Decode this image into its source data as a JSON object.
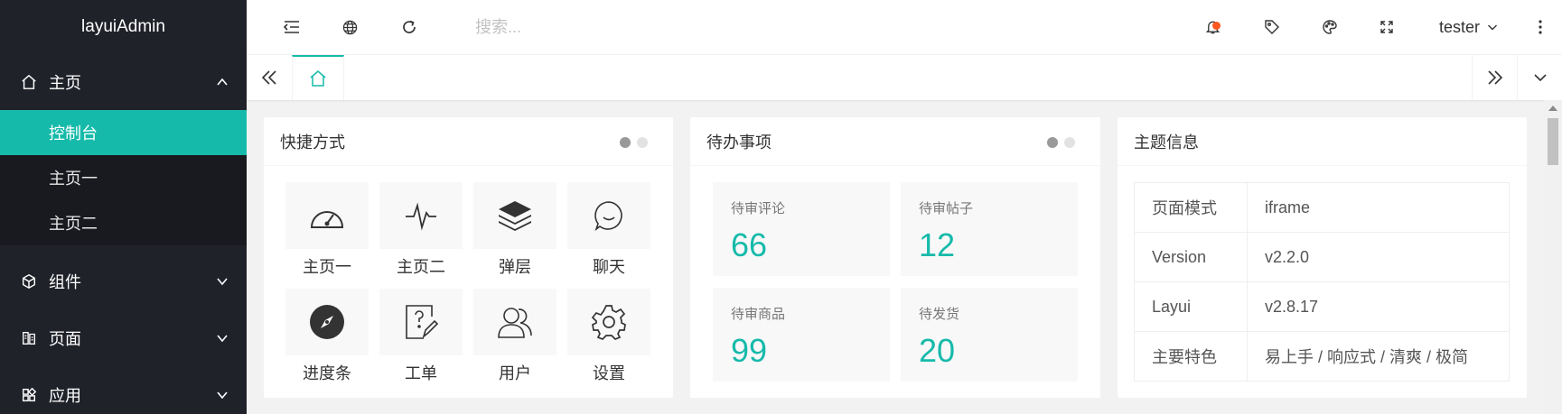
{
  "sidebar": {
    "logo": "layuiAdmin",
    "groups": [
      {
        "label": "主页",
        "icon": "home-icon",
        "expanded": true,
        "children": [
          {
            "label": "控制台",
            "active": true
          },
          {
            "label": "主页一"
          },
          {
            "label": "主页二"
          }
        ]
      },
      {
        "label": "组件",
        "icon": "component-icon"
      },
      {
        "label": "页面",
        "icon": "page-icon"
      },
      {
        "label": "应用",
        "icon": "app-icon"
      }
    ]
  },
  "header": {
    "search_placeholder": "搜索...",
    "user": "tester",
    "icons": [
      "menu-collapse-icon",
      "globe-icon",
      "refresh-icon",
      "bell-icon",
      "tag-icon",
      "palette-icon",
      "fullscreen-icon",
      "more-vertical-icon"
    ]
  },
  "tabs": {
    "home_icon": "home-icon"
  },
  "cards": {
    "shortcuts": {
      "title": "快捷方式",
      "items": [
        {
          "label": "主页一",
          "icon": "dashboard-icon"
        },
        {
          "label": "主页二",
          "icon": "pulse-icon"
        },
        {
          "label": "弹层",
          "icon": "layers-icon"
        },
        {
          "label": "聊天",
          "icon": "chat-icon"
        },
        {
          "label": "进度条",
          "icon": "compass-icon"
        },
        {
          "label": "工单",
          "icon": "ticket-icon"
        },
        {
          "label": "用户",
          "icon": "users-icon"
        },
        {
          "label": "设置",
          "icon": "gear-icon"
        }
      ]
    },
    "todo": {
      "title": "待办事项",
      "items": [
        {
          "label": "待审评论",
          "value": "66"
        },
        {
          "label": "待审帖子",
          "value": "12"
        },
        {
          "label": "待审商品",
          "value": "99"
        },
        {
          "label": "待发货",
          "value": "20"
        }
      ]
    },
    "theme": {
      "title": "主题信息",
      "rows": [
        {
          "key": "页面模式",
          "value": "iframe"
        },
        {
          "key": "Version",
          "value": "v2.2.0"
        },
        {
          "key": "Layui",
          "value": "v2.8.17"
        },
        {
          "key": "主要特色",
          "value": "易上手 / 响应式 / 清爽 / 极简"
        }
      ]
    }
  },
  "colors": {
    "accent": "#16baaa",
    "sidebar": "#20222a",
    "badge": "#ff5722"
  }
}
